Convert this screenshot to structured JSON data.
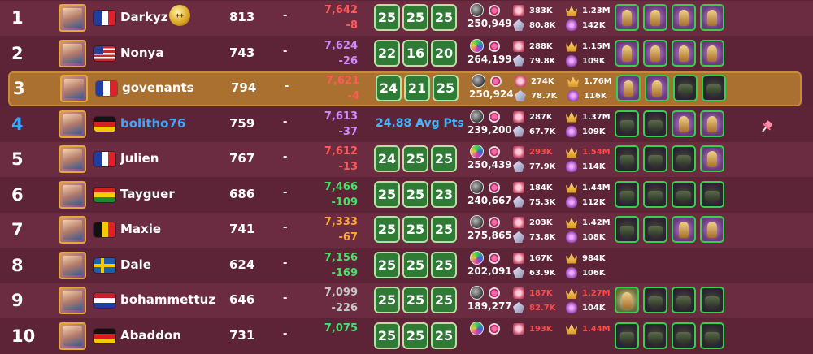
{
  "accent_green": "#2f7a35",
  "highlight_color": "#a9702f",
  "player_color_blue": "#39a8ff",
  "rows": [
    {
      "rank": "1",
      "name": "Darkyz",
      "flag": "fr",
      "level": "813",
      "dash": "-",
      "pts": "7,642",
      "delta": "-8",
      "pts_color": "#ff5a5a",
      "boxes": [
        "25",
        "25",
        "25"
      ],
      "avg": "",
      "power": "250,949",
      "atk": "383K",
      "def": "80.8K",
      "crown": "1.23M",
      "q": "142K",
      "stat_warn": false,
      "teams": [
        "purple",
        "purple",
        "purple",
        "purple"
      ],
      "badge": "++"
    },
    {
      "rank": "2",
      "name": "Nonya",
      "flag": "us",
      "level": "743",
      "dash": "-",
      "pts": "7,624",
      "delta": "-26",
      "pts_color": "#d08cff",
      "boxes": [
        "22",
        "16",
        "20"
      ],
      "avg": "",
      "power": "264,199",
      "atk": "288K",
      "def": "79.8K",
      "crown": "1.15M",
      "q": "109K",
      "stat_warn": false,
      "teams": [
        "purple",
        "purple",
        "purple",
        "purple"
      ]
    },
    {
      "rank": "3",
      "name": "govenants",
      "flag": "fr",
      "level": "794",
      "dash": "-",
      "pts": "7,621",
      "delta": "-4",
      "pts_color": "#ff5a5a",
      "boxes": [
        "24",
        "21",
        "25"
      ],
      "avg": "",
      "power": "250,924",
      "atk": "274K",
      "def": "78.7K",
      "crown": "1.76M",
      "q": "116K",
      "stat_warn": false,
      "teams": [
        "purple",
        "purple",
        "dark",
        "dark"
      ]
    },
    {
      "rank": "4",
      "name": "bolitho76",
      "flag": "de",
      "level": "759",
      "dash": "-",
      "pts": "7,613",
      "delta": "-37",
      "pts_color": "#d08cff",
      "boxes": [],
      "avg": "24.88 Avg Pts",
      "power": "239,200",
      "atk": "287K",
      "def": "67.7K",
      "crown": "1.37M",
      "q": "109K",
      "stat_warn": false,
      "teams": [
        "dark",
        "dark",
        "purple",
        "purple"
      ]
    },
    {
      "rank": "5",
      "name": "Julien",
      "flag": "fr",
      "level": "767",
      "dash": "-",
      "pts": "7,612",
      "delta": "-13",
      "pts_color": "#ff5a5a",
      "boxes": [
        "24",
        "25",
        "25"
      ],
      "avg": "",
      "power": "250,439",
      "atk": "293K",
      "def": "77.9K",
      "crown": "1.54M",
      "q": "114K",
      "stat_warn": true,
      "teams": [
        "dark",
        "dark",
        "dark",
        "purple"
      ]
    },
    {
      "rank": "6",
      "name": "Tayguer",
      "flag": "bo",
      "level": "686",
      "dash": "-",
      "pts": "7,466",
      "delta": "-109",
      "pts_color": "#46e06a",
      "boxes": [
        "25",
        "25",
        "23"
      ],
      "avg": "",
      "power": "240,667",
      "atk": "184K",
      "def": "75.3K",
      "crown": "1.44M",
      "q": "112K",
      "stat_warn": false,
      "teams": [
        "dark",
        "dark",
        "dark",
        "dark"
      ]
    },
    {
      "rank": "7",
      "name": "Maxie",
      "flag": "be",
      "level": "741",
      "dash": "-",
      "pts": "7,333",
      "delta": "-67",
      "pts_color": "#ffa63a",
      "boxes": [
        "25",
        "25",
        "25"
      ],
      "avg": "",
      "power": "275,865",
      "atk": "203K",
      "def": "73.8K",
      "crown": "1.42M",
      "q": "108K",
      "stat_warn": false,
      "teams": [
        "dark",
        "dark",
        "purple",
        "purple"
      ]
    },
    {
      "rank": "8",
      "name": "Dale",
      "flag": "se",
      "level": "624",
      "dash": "-",
      "pts": "7,156",
      "delta": "-169",
      "pts_color": "#46e06a",
      "boxes": [
        "25",
        "25",
        "25"
      ],
      "avg": "",
      "power": "202,091",
      "atk": "167K",
      "def": "63.9K",
      "crown": "984K",
      "q": "106K",
      "stat_warn": false,
      "teams": []
    },
    {
      "rank": "9",
      "name": "bohammettuz",
      "flag": "nl",
      "level": "646",
      "dash": "-",
      "pts": "7,099",
      "delta": "-226",
      "pts_color": "#c8c8c8",
      "boxes": [
        "25",
        "25",
        "25"
      ],
      "avg": "",
      "power": "189,277",
      "atk": "187K",
      "def": "82.7K",
      "crown": "1.27M",
      "q": "104K",
      "stat_warn": true,
      "teams": [
        "leaf",
        "dark",
        "dark",
        "dark"
      ]
    },
    {
      "rank": "10",
      "name": "Abaddon",
      "flag": "de",
      "level": "731",
      "dash": "-",
      "pts": "7,075",
      "delta": "",
      "pts_color": "#46e06a",
      "boxes": [
        "25",
        "25",
        "25"
      ],
      "avg": "",
      "power": "",
      "atk": "193K",
      "def": "",
      "crown": "1.44M",
      "q": "",
      "stat_warn": true,
      "teams": [
        "dark",
        "dark",
        "dark",
        "dark"
      ]
    }
  ]
}
